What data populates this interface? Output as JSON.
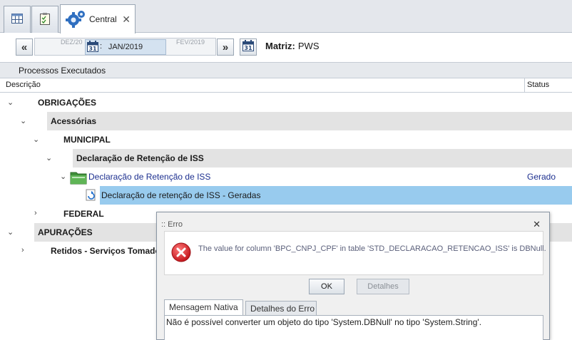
{
  "tabs": {
    "icons": [
      "grid-icon",
      "checklist-icon"
    ],
    "active_label": "Central",
    "close_symbol": "✕"
  },
  "period": {
    "prev_label": "DEZ/20",
    "current_label": "JAN/2019",
    "next_label": "FEV/2019",
    "colon": ":",
    "first_symbol": "«",
    "next_symbol": "»"
  },
  "matriz": {
    "label": "Matriz:",
    "value": "PWS"
  },
  "panel": {
    "title": "Processos Executados"
  },
  "columns": {
    "description": "Descrição",
    "status": "Status"
  },
  "tree": {
    "obrigacoes": "OBRIGAÇÕES",
    "acessorias": "Acessórias",
    "municipal": "MUNICIPAL",
    "decl_group": "Declaração de Retenção de ISS",
    "decl_item": "Declaração de Retenção de ISS",
    "decl_item_status": "Gerado",
    "decl_sub": "Declaração de retenção de ISS - Geradas",
    "federal": "FEDERAL",
    "apuracoes": "APURAÇÕES",
    "retidos": "Retidos - Serviços Tomado"
  },
  "error_dialog": {
    "title": ":: Erro",
    "close_symbol": "✕",
    "message": "The value for column 'BPC_CNPJ_CPF' in table 'STD_DECLARACAO_RETENCAO_ISS' is DBNull.",
    "ok_label": "OK",
    "details_label": "Detalhes",
    "tab_native": "Mensagem Nativa",
    "tab_details": "Detalhes do Erro",
    "native_message": "Não é possível converter um objeto do tipo 'System.DBNull' no tipo 'System.String'."
  },
  "colors": {
    "selection": "#98cbee",
    "link": "#1c2f8f",
    "error_red": "#d8232a"
  }
}
